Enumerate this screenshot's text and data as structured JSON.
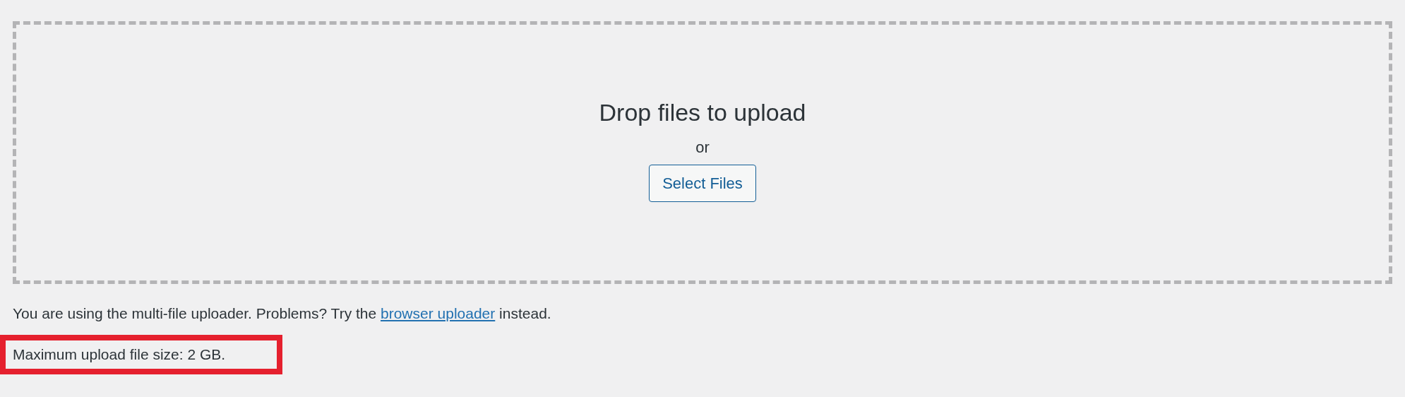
{
  "drop_zone": {
    "title": "Drop files to upload",
    "separator": "or",
    "button": "Select Files"
  },
  "notice": {
    "before": "You are using the multi-file uploader. Problems? Try the ",
    "link": "browser uploader",
    "after": " instead."
  },
  "max_size": {
    "text": "Maximum upload file size: 2 GB.",
    "highlighted": true
  }
}
